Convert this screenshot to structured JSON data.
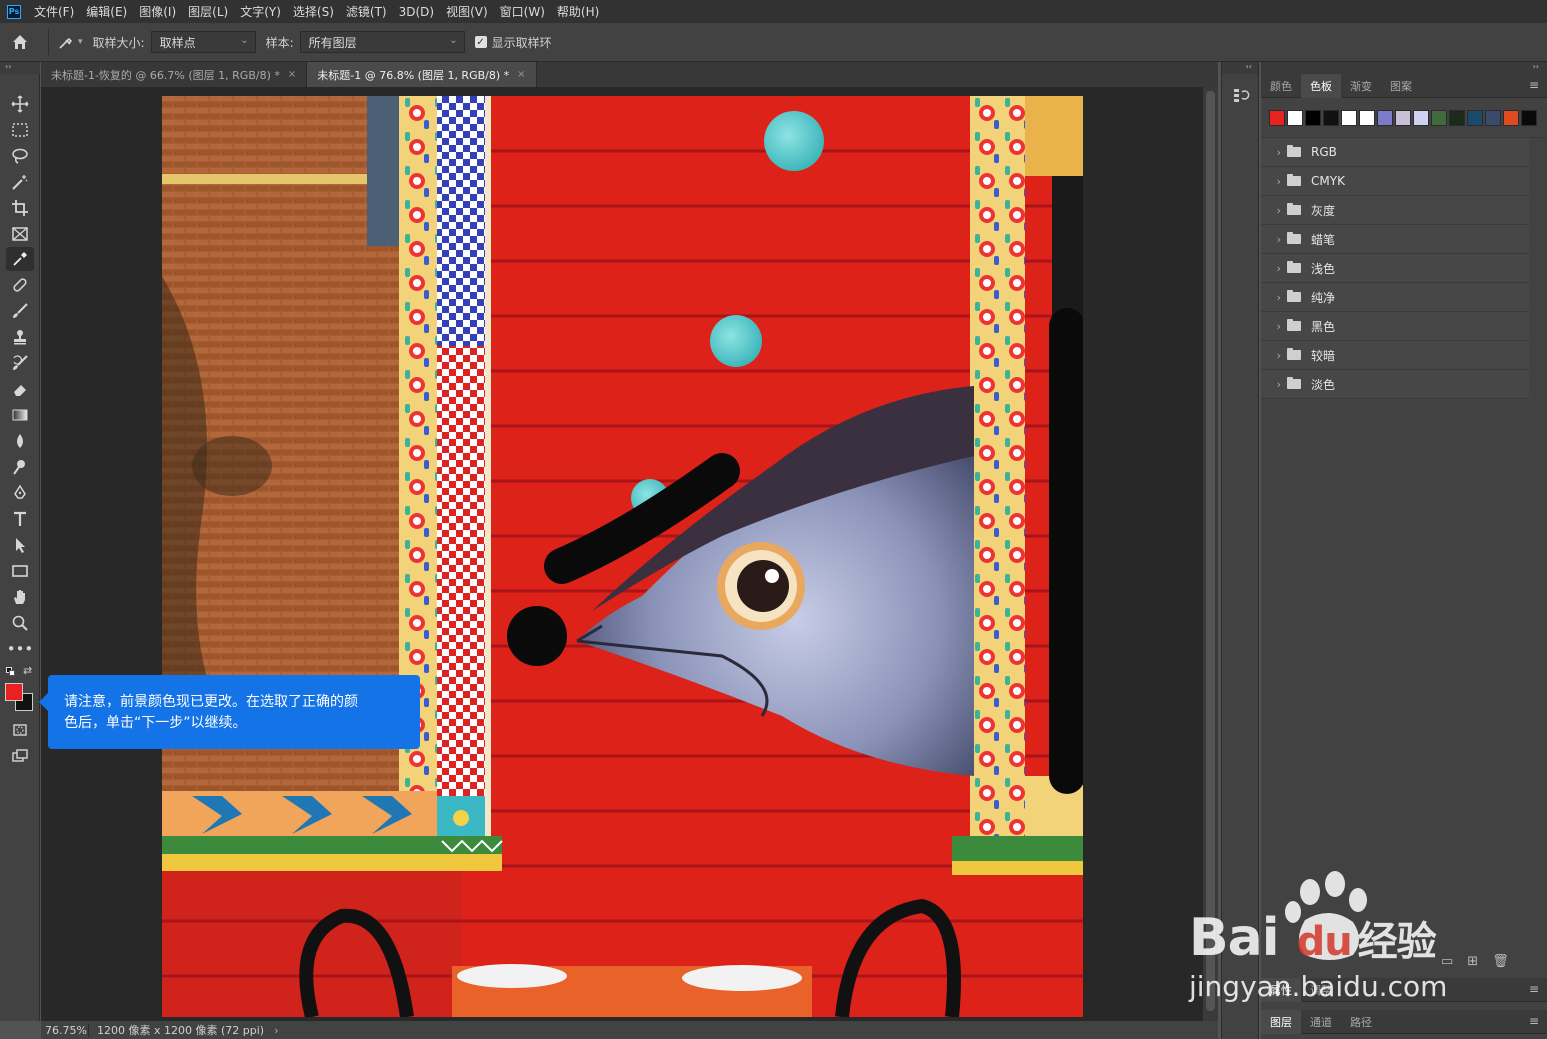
{
  "app": {
    "logo": "Ps"
  },
  "menu": [
    "文件(F)",
    "编辑(E)",
    "图像(I)",
    "图层(L)",
    "文字(Y)",
    "选择(S)",
    "滤镜(T)",
    "3D(D)",
    "视图(V)",
    "窗口(W)",
    "帮助(H)"
  ],
  "options": {
    "sample_size_label": "取样大小:",
    "sample_size_value": "取样点",
    "sample_label": "样本:",
    "sample_value": "所有图层",
    "show_ring_label": "显示取样环",
    "show_ring_checked": true
  },
  "tabs": [
    {
      "label": "未标题-1-恢复的 @ 66.7% (图层 1, RGB/8) *",
      "close": "×"
    },
    {
      "label": "未标题-1 @ 76.8% (图层 1, RGB/8) *",
      "close": "×"
    }
  ],
  "status": {
    "zoom": "76.75%",
    "info": "1200 像素 x 1200 像素 (72 ppi)",
    "arrow": "›"
  },
  "tooltip": {
    "line1": "请注意，前景颜色现已更改。在选取了正确的颜",
    "line2": "色后，单击“下一步”以继续。"
  },
  "colors": {
    "foreground": "#e8231f",
    "background": "#111111",
    "tooltip_bg": "#1473e6"
  },
  "panel": {
    "tabs": [
      "颜色",
      "色板",
      "渐变",
      "图案"
    ],
    "active_tab": "色板",
    "swatches": [
      "#e8231f",
      "#ffffff",
      "#000000",
      "#111111",
      "#ffffff",
      "#ffffff",
      "#7b7bc8",
      "#c9c0d8",
      "#d0d0f0",
      "#3f6b3f",
      "#1c2a1c",
      "#1a4a6a",
      "#3a4a6a",
      "#e04a20",
      "#0a0a0a"
    ],
    "groups": [
      "RGB",
      "CMYK",
      "灰度",
      "蜡笔",
      "浅色",
      "纯净",
      "黑色",
      "较暗",
      "淡色"
    ],
    "props_tabs": [
      "属性",
      "调整"
    ],
    "layers_tabs": [
      "图层",
      "通道",
      "路径"
    ]
  },
  "watermark": {
    "brand": "Bai",
    "du": "du",
    "suffix": "经验",
    "url": "jingyan.baidu.com"
  }
}
